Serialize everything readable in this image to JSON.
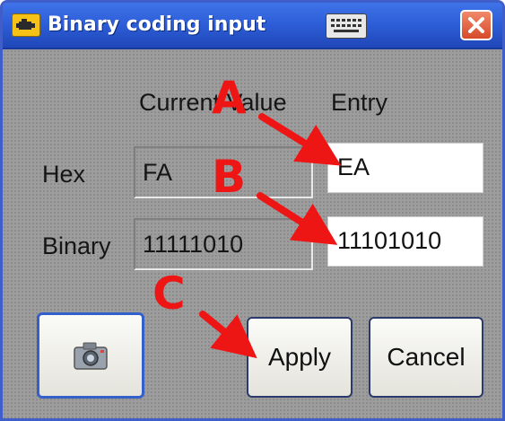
{
  "window": {
    "title": "Binary coding input",
    "app_icon": "engine-icon",
    "keyboard_icon": "keyboard-icon",
    "close_icon": "close-icon"
  },
  "columns": {
    "current_value": "Current Value",
    "entry": "Entry"
  },
  "rows": [
    {
      "label": "Hex",
      "current": "FA",
      "entry": "EA"
    },
    {
      "label": "Binary",
      "current": "11111010",
      "entry": "11101010"
    }
  ],
  "buttons": {
    "camera_icon": "camera-icon",
    "apply": "Apply",
    "cancel": "Cancel"
  },
  "annotations": [
    "A",
    "B",
    "C"
  ],
  "colors": {
    "annotation": "#ee1515",
    "titlebar": "#2e5fd9",
    "window_body": "#9d9d9d"
  }
}
